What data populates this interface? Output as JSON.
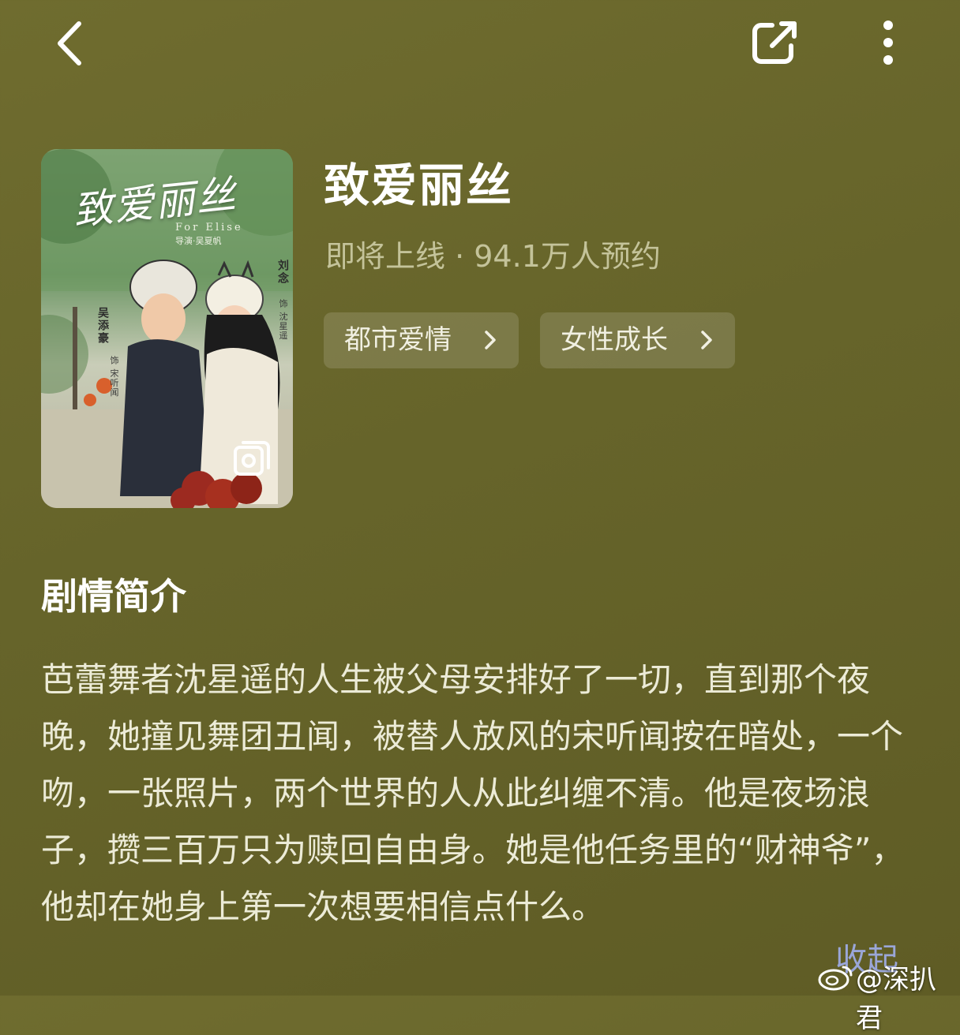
{
  "topbar": {
    "back_icon": "chevron-left-icon",
    "share_icon": "share-external-icon",
    "more_icon": "more-vertical-icon"
  },
  "poster": {
    "title_art": "致爱丽丝",
    "subtitle_art": "For Elise",
    "director_art": "导演·吴夏帆",
    "actor_left": "吴添豪",
    "role_left": "饰 宋听闻",
    "actor_right": "刘念",
    "role_right": "饰 沈星遥",
    "badge_icon": "gallery-icon"
  },
  "show": {
    "title": "致爱丽丝",
    "status": "即将上线 · 94.1万人预约",
    "tags": [
      {
        "label": "都市爱情"
      },
      {
        "label": "女性成长"
      }
    ]
  },
  "synopsis": {
    "heading": "剧情简介",
    "text": "芭蕾舞者沈星遥的人生被父母安排好了一切，直到那个夜晚，她撞见舞团丑闻，被替人放风的宋听闻按在暗处，一个吻，一张照片，两个世界的人从此纠缠不清。他是夜场浪子，攒三百万只为赎回自由身。她是他任务里的“财神爷”，他却在她身上第一次想要相信点什么。",
    "collapse_label": "收起"
  },
  "watermark": {
    "icon": "weibo-icon",
    "text": "@深扒君"
  },
  "colors": {
    "background": "#66642a",
    "status_text": "#c4c39a",
    "tag_bg": "rgba(255,255,255,0.14)",
    "collapse_link": "#9aa6d8"
  }
}
